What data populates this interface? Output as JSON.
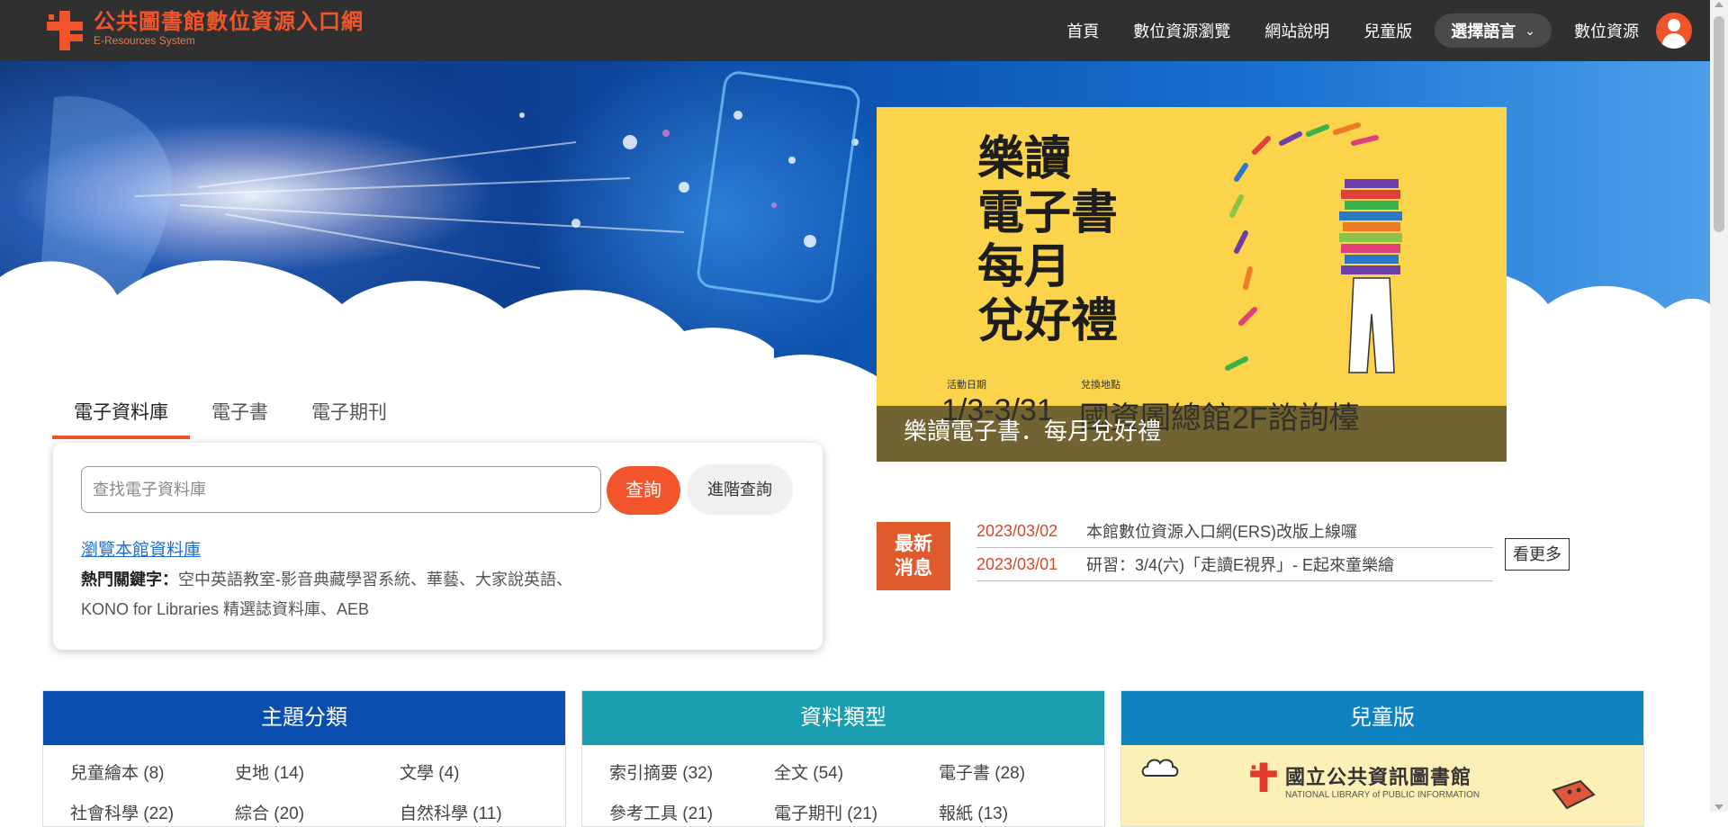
{
  "header": {
    "logo_title": "公共圖書館數位資源入口網",
    "logo_subtitle": "E-Resources System",
    "nav": [
      "首頁",
      "數位資源瀏覽",
      "網站說明",
      "兒童版"
    ],
    "language_label": "選擇語言",
    "digital_resources_label": "數位資源"
  },
  "banner": {
    "headline": [
      "樂讀",
      "電子書",
      "每月",
      "兌好禮"
    ],
    "activity_date_label": "活動日期",
    "activity_date": "1/3-3/31",
    "location_label": "兌換地點",
    "location": "國資圖總館2F諮詢檯",
    "caption": "樂讀電子書．每月兌好禮"
  },
  "search": {
    "tabs": [
      "電子資料庫",
      "電子書",
      "電子期刊"
    ],
    "active_tab": "電子資料庫",
    "placeholder": "查找電子資料庫",
    "search_button": "查詢",
    "advanced_button": "進階查詢",
    "browse_link": "瀏覽本館資料庫",
    "hot_label": "熱門關鍵字：",
    "hot_keywords_line1": "空中英語教室-影音典藏學習系統、華藝、大家說英語、",
    "hot_keywords_line2": "KONO for Libraries 精選誌資料庫、AEB"
  },
  "news": {
    "badge_line1": "最新",
    "badge_line2": "消息",
    "items": [
      {
        "date": "2023/03/02",
        "title": "本館數位資源入口網(ERS)改版上線囉"
      },
      {
        "date": "2023/03/01",
        "title": "研習：3/4(六)「走讀E視界」- E起來童樂繪"
      }
    ],
    "more": "看更多"
  },
  "categories": {
    "subject": {
      "title": "主題分類",
      "color": "#0a4fb0",
      "items": [
        "兒童繪本 (8)",
        "史地 (14)",
        "文學 (4)",
        "社會科學 (22)",
        "綜合 (20)",
        "自然科學 (11)"
      ]
    },
    "type": {
      "title": "資料類型",
      "color": "#1a9fb0",
      "items": [
        "索引摘要 (32)",
        "全文 (54)",
        "電子書 (28)",
        "參考工具 (21)",
        "電子期刊 (21)",
        "報紙 (13)"
      ]
    },
    "kids": {
      "title": "兒童版",
      "color": "#0f82c2",
      "logo_title": "國立公共資訊圖書館",
      "logo_subtitle": "NATIONAL LIBRARY of PUBLIC INFORMATION"
    }
  },
  "colors": {
    "accent": "#f2552c",
    "header_bg": "#303030",
    "banner_yellow": "#fbd44b"
  }
}
